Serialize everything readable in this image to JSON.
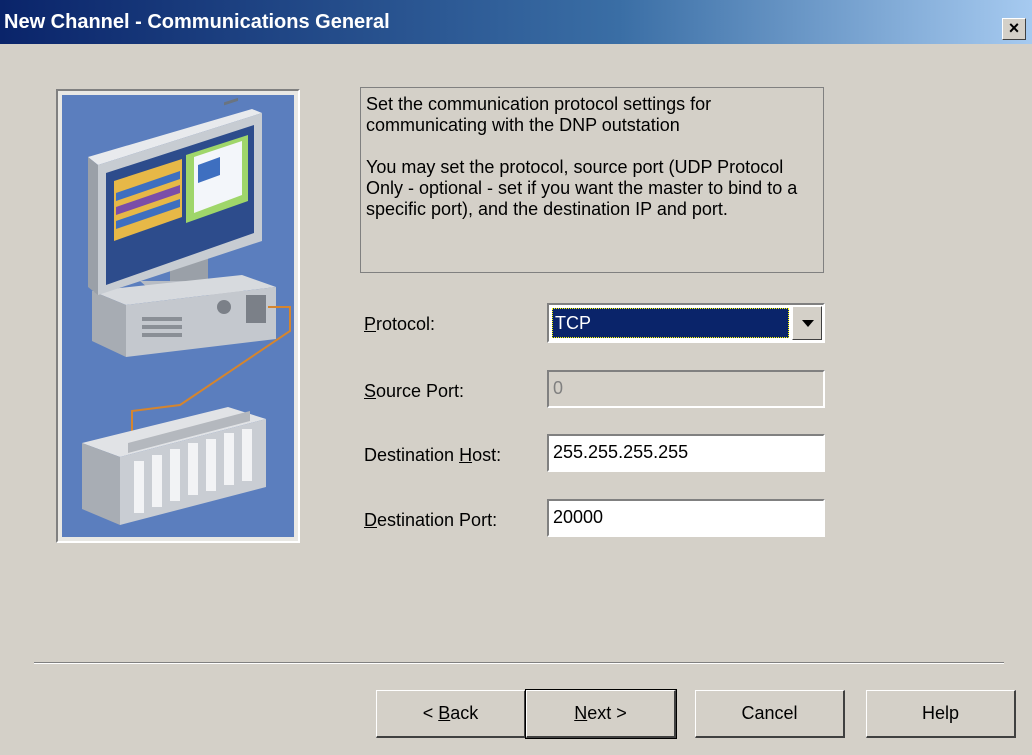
{
  "window": {
    "title": "New Channel - Communications General",
    "close_glyph": "×"
  },
  "description": {
    "paragraph1": "Set the communication protocol settings for communicating with the DNP outstation",
    "paragraph2": "You may set the protocol, source port (UDP Protocol Only - optional - set if you want the master to bind to a specific port), and the destination IP and port."
  },
  "fields": {
    "protocol": {
      "label_mnemonic": "P",
      "label_rest": "rotocol:",
      "value": "TCP",
      "options": [
        "TCP"
      ]
    },
    "source_port": {
      "label_mnemonic": "S",
      "label_rest": "ource Port:",
      "value": "0",
      "enabled": false
    },
    "destination_host": {
      "label_prefix": "Destination ",
      "label_mnemonic": "H",
      "label_rest": "ost:",
      "value": "255.255.255.255"
    },
    "destination_port": {
      "label_mnemonic": "D",
      "label_rest": "estination Port:",
      "value": "20000"
    }
  },
  "buttons": {
    "back": {
      "prefix": "< ",
      "mnemonic": "B",
      "rest": "ack"
    },
    "next": {
      "mnemonic": "N",
      "rest": "ext >"
    },
    "cancel": {
      "label": "Cancel"
    },
    "help": {
      "label": "Help"
    }
  },
  "colors": {
    "titlebar_start": "#0a246a",
    "titlebar_end": "#a6caf0",
    "dialog_bg": "#d4d0c8",
    "selection": "#0a246a",
    "illustration_bg": "#5b7ebe"
  },
  "icons": {
    "illustration": "computer-and-plc-network-illustration",
    "dropdown": "chevron-down-icon",
    "close": "close-icon"
  }
}
